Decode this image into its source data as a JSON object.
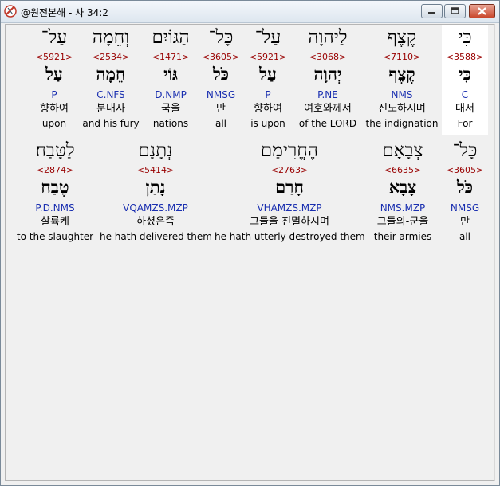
{
  "window": {
    "title": "@원전본해 - 사 34:2",
    "icon": "bible-app-icon"
  },
  "rows": [
    [
      {
        "heb": "כִּי",
        "strong": "<3588>",
        "root": "כִּי",
        "morph": "C",
        "kor": "대저",
        "eng": "For",
        "highlight": true
      },
      {
        "heb": "קֶצֶף",
        "strong": "<7110>",
        "root": "קֶצֶף",
        "morph": "NMS",
        "kor": "진노하시며",
        "eng": "the indignation"
      },
      {
        "heb": "לַיהוָה",
        "strong": "<3068>",
        "root": "יְהוָה",
        "morph": "P.NE",
        "kor": "여호와께서",
        "eng": "of the LORD"
      },
      {
        "heb": "עַל־",
        "strong": "<5921>",
        "root": "עַל",
        "morph": "P",
        "kor": "향하여",
        "eng": "is upon"
      },
      {
        "heb": "כָּל־",
        "strong": "<3605>",
        "root": "כֹּל",
        "morph": "NMSG",
        "kor": "만",
        "eng": "all"
      },
      {
        "heb": "הַגּוֹיִם",
        "strong": "<1471>",
        "root": "גּוֹי",
        "morph": "D.NMP",
        "kor": "국을",
        "eng": "nations"
      },
      {
        "heb": "וְחֵמָה",
        "strong": "<2534>",
        "root": "חֵמָה",
        "morph": "C.NFS",
        "kor": "분내사",
        "eng": "and his fury"
      },
      {
        "heb": "עַל־",
        "strong": "<5921>",
        "root": "עַל",
        "morph": "P",
        "kor": "향하여",
        "eng": "upon"
      }
    ],
    [
      {
        "heb": "כָּל־",
        "strong": "<3605>",
        "root": "כֹּל",
        "morph": "NMSG",
        "kor": "만",
        "eng": "all"
      },
      {
        "heb": "צְבָאָם",
        "strong": "<6635>",
        "root": "צָבָא",
        "morph": "NMS.MZP",
        "kor": "그들의-군을",
        "eng": "their armies"
      },
      {
        "heb": "הֶחֱרִימָם",
        "strong": "<2763>",
        "root": "חָרַם",
        "morph": "VHAMZS.MZP",
        "kor": "그들을 진멸하시며",
        "eng": "he hath utterly destroyed them"
      },
      {
        "heb": "נְתָנָם",
        "strong": "<5414>",
        "root": "נָתַן",
        "morph": "VQAMZS.MZP",
        "kor": "하셨은즉",
        "eng": "he hath delivered them"
      },
      {
        "heb": "לַטָּבַח׃",
        "strong": "<2874>",
        "root": "טֶבַח",
        "morph": "P.D.NMS",
        "kor": "살륙케",
        "eng": "to the slaughter"
      }
    ]
  ]
}
